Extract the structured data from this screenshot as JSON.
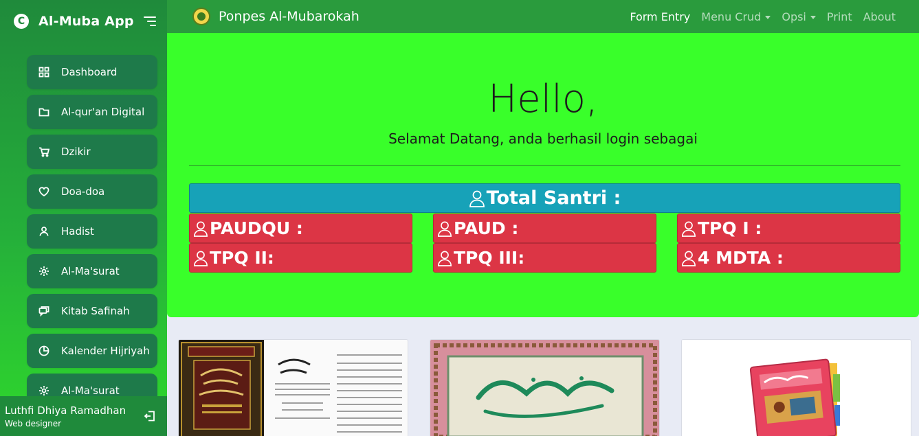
{
  "sidebar": {
    "brand_title": "Al-Muba App",
    "items": [
      {
        "label": "Dashboard",
        "icon": "grid-icon"
      },
      {
        "label": "Al-qur'an Digital",
        "icon": "folder-icon"
      },
      {
        "label": "Dzikir",
        "icon": "cart-icon"
      },
      {
        "label": "Doa-doa",
        "icon": "heart-icon"
      },
      {
        "label": "Hadist",
        "icon": "user-icon"
      },
      {
        "label": "Al-Ma'surat",
        "icon": "gear-icon"
      },
      {
        "label": "Kitab Safinah",
        "icon": "chat-icon"
      },
      {
        "label": "Kalender Hijriyah",
        "icon": "pie-chart-icon"
      },
      {
        "label": "Al-Ma'surat",
        "icon": "gear-icon"
      }
    ],
    "user": {
      "name": "Luthfi Dhiya Ramadhan",
      "role": "Web designer"
    }
  },
  "topbar": {
    "site_title": "Ponpes Al-Mubarokah",
    "nav": {
      "form_entry": "Form Entry",
      "menu_crud": "Menu Crud",
      "opsi": "Opsi",
      "print": "Print",
      "about": "About"
    }
  },
  "hero": {
    "hello": "Hello,",
    "welcome": "Selamat Datang, anda berhasil login sebagai",
    "total_santri": "Total Santri :",
    "cards": [
      "PAUDQU :",
      "PAUD :",
      "TPQ I :",
      "TPQ II:",
      "TPQ III:",
      "4 MDTA :"
    ]
  },
  "colors": {
    "sidebar": "#1f8a3b",
    "topbar": "#2a9b3d",
    "hero": "#39ff2a",
    "info": "#17a2b8",
    "danger": "#dc3545"
  }
}
